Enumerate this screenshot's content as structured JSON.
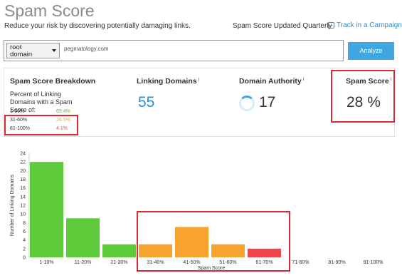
{
  "header": {
    "title": "Spam Score",
    "subtitle": "Reduce your risk by discovering potentially damaging links.",
    "updated": "Spam Score Updated Quarterly",
    "track_link": "Track in a Campaign"
  },
  "search": {
    "scope_line1": "root",
    "scope_line2": "domain",
    "url": "pegmatology.com",
    "analyze_label": "Analyze"
  },
  "breakdown": {
    "heading": "Spam Score Breakdown",
    "percent_label": "Percent of Linking Domains with a Spam Score of:",
    "buckets": [
      {
        "range": "1-30%",
        "value": "69.4%",
        "color": "#5dbb2f"
      },
      {
        "range": "31-60%",
        "value": "26.5%",
        "color": "#f7a43a"
      },
      {
        "range": "61-100%",
        "value": "4.1%",
        "color": "#e8464a"
      }
    ]
  },
  "linking_domains": {
    "heading": "Linking Domains",
    "info": "i",
    "value": "55"
  },
  "domain_authority": {
    "heading": "Domain Authority",
    "info": "i",
    "value": "17"
  },
  "spam_score": {
    "heading": "Spam Score",
    "info": "i",
    "value": "28 %"
  },
  "colors": {
    "accent": "#3fa6e1",
    "green": "#5dcb3a",
    "orange": "#f8a32d",
    "red": "#f0454a",
    "highlight": "#d62a35"
  },
  "chart_data": {
    "type": "bar",
    "categories": [
      "1-10%",
      "11-20%",
      "21-30%",
      "31-40%",
      "41-50%",
      "51-60%",
      "61-70%",
      "71-80%",
      "81-90%",
      "91-100%"
    ],
    "values": [
      22,
      9,
      3,
      3,
      7,
      3,
      2,
      0,
      0,
      0
    ],
    "colors": [
      "#5dcb3a",
      "#5dcb3a",
      "#5dcb3a",
      "#f8a32d",
      "#f8a32d",
      "#f8a32d",
      "#f0454a",
      "#f0454a",
      "#f0454a",
      "#f0454a"
    ],
    "xlabel": "Spam Score",
    "ylabel": "Number of Linking Domains",
    "ylim": [
      0,
      24
    ],
    "yticks": [
      0,
      2,
      4,
      6,
      8,
      10,
      12,
      14,
      16,
      18,
      20,
      22,
      24
    ],
    "grid": false
  }
}
